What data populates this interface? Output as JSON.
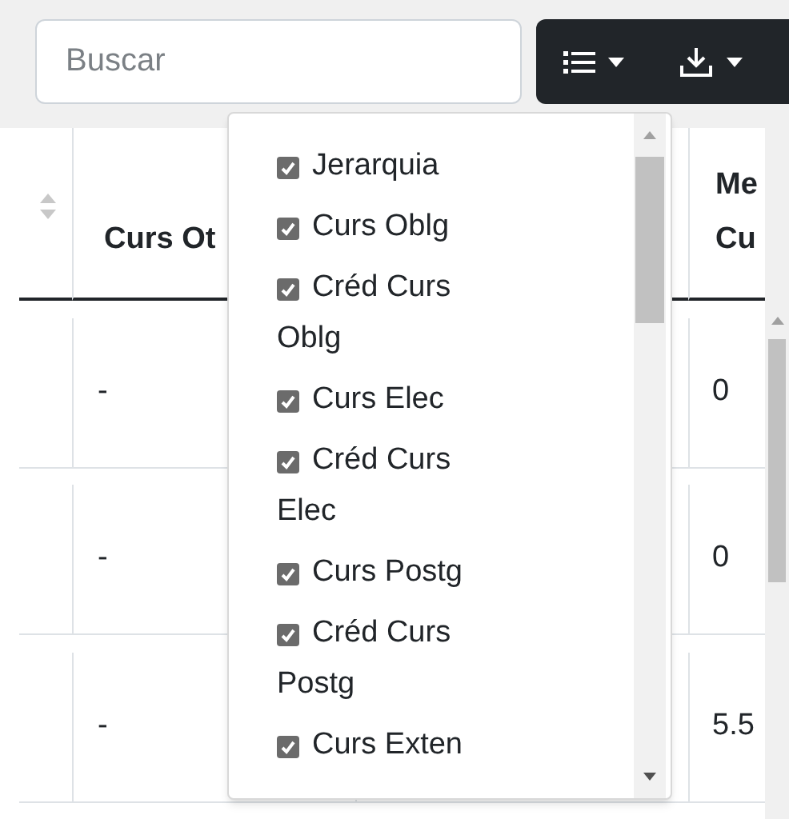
{
  "search": {
    "placeholder": "Buscar"
  },
  "toolbar": [
    {
      "kind": "columns"
    },
    {
      "kind": "download"
    }
  ],
  "table": {
    "columns": [
      {
        "kind": "sort"
      },
      {
        "kind": "text",
        "label": "Curs Ot"
      },
      {
        "kind": "blank"
      },
      {
        "kind": "text",
        "label": "Me Cu"
      }
    ],
    "rows": [
      [
        "",
        "-",
        "",
        "0"
      ],
      [
        "",
        "-",
        "",
        "0"
      ],
      [
        "",
        "-",
        "",
        "5.5"
      ]
    ]
  },
  "columns_menu": {
    "items": [
      {
        "label": "Jerarquia",
        "checked": true
      },
      {
        "label": "Curs Oblg",
        "checked": true
      },
      {
        "label": "Créd Curs Oblg",
        "checked": true
      },
      {
        "label": "Curs Elec",
        "checked": true
      },
      {
        "label": "Créd Curs Elec",
        "checked": true
      },
      {
        "label": "Curs Postg",
        "checked": true
      },
      {
        "label": "Créd Curs Postg",
        "checked": true
      },
      {
        "label": "Curs Exten",
        "checked": true
      }
    ]
  }
}
